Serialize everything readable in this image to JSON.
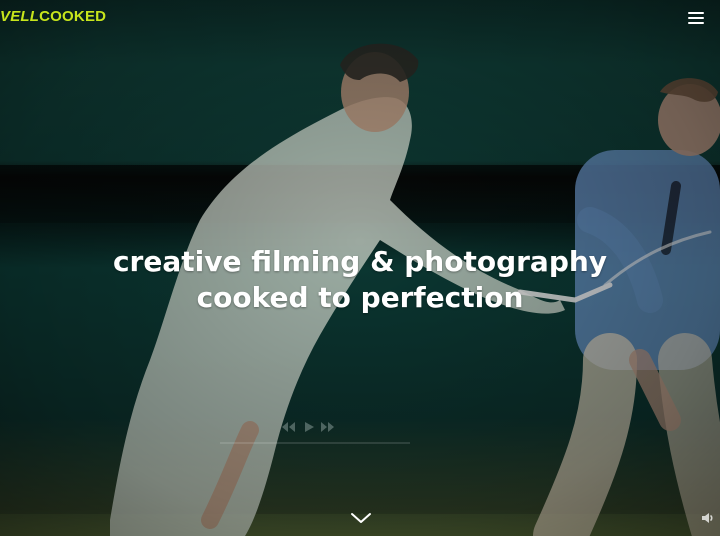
{
  "header": {
    "logo_prefix": "VELL",
    "logo_suffix": "COOKED",
    "menu_icon": "hamburger-menu-icon"
  },
  "hero": {
    "headline_line1": "creative filming & photography",
    "headline_line2": "cooked to perfection",
    "scroll_icon": "chevron-down-icon",
    "sound_icon": "speaker-icon"
  },
  "colors": {
    "brand": "#c7e51c",
    "text": "#ffffff",
    "bg": "#0c2b28"
  }
}
